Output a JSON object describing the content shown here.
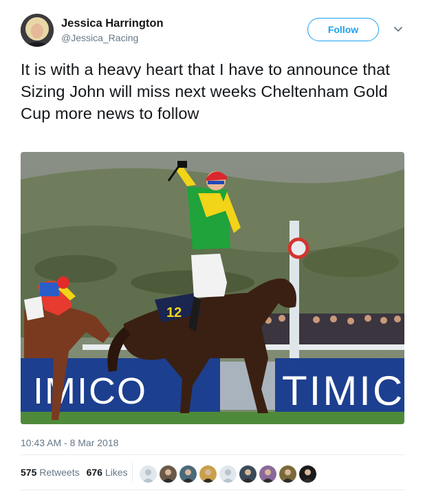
{
  "author": {
    "name": "Jessica Harrington",
    "handle": "@Jessica_Racing"
  },
  "follow_label": "Follow",
  "tweet_text": "It is with a heavy heart that I have to announce that Sizing John will miss next weeks Cheltenham Gold Cup more news to follow",
  "photo": {
    "banner_left_text": "IMICO",
    "banner_right_text": "TIMIC",
    "saddle_number": "12"
  },
  "timestamp": "10:43 AM - 8 Mar 2018",
  "stats": {
    "retweets_count": "575",
    "retweets_label": "Retweets",
    "likes_count": "676",
    "likes_label": "Likes"
  },
  "likers": [
    {
      "icon": "default-avatar-icon",
      "color": "#b9c3cc"
    },
    {
      "icon": "user-avatar-icon",
      "color": "#6b5a4a"
    },
    {
      "icon": "user-avatar-icon",
      "color": "#4a6a7a"
    },
    {
      "icon": "user-avatar-icon",
      "color": "#c9a04a"
    },
    {
      "icon": "default-avatar-icon",
      "color": "#b9c3cc"
    },
    {
      "icon": "user-avatar-icon",
      "color": "#3a4a5a"
    },
    {
      "icon": "user-avatar-icon",
      "color": "#8a6a9a"
    },
    {
      "icon": "user-avatar-icon",
      "color": "#7a6a3a"
    },
    {
      "icon": "user-avatar-icon",
      "color": "#1a1a1a"
    }
  ],
  "colors": {
    "accent": "#1da1f2",
    "muted": "#657786",
    "divider": "#e6ecf0"
  }
}
